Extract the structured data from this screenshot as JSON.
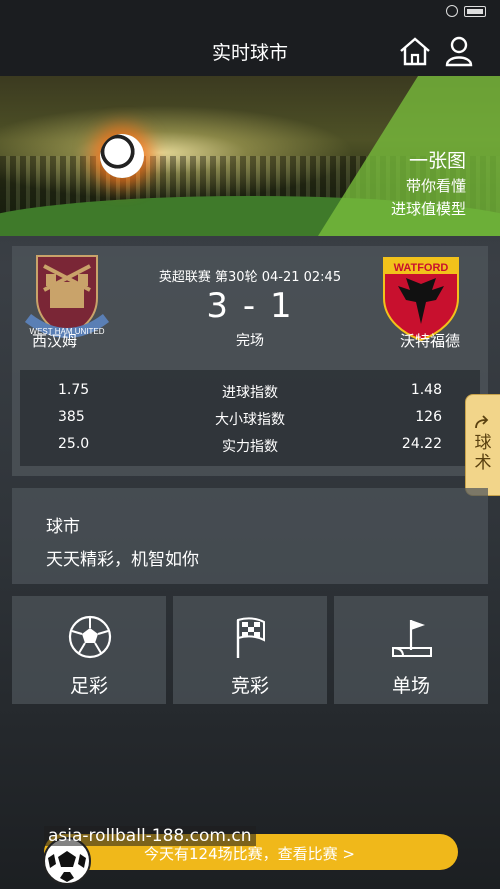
{
  "nav": {
    "title": "实时球市"
  },
  "banner": {
    "line1": "一张图",
    "line2": "带你看懂",
    "line3": "进球值模型"
  },
  "match": {
    "league_round_time": "英超联赛 第30轮 04-21 02:45",
    "score": "3 - 1",
    "status": "完场",
    "home": {
      "name": "西汉姆",
      "logo_text": "WEST HAM UNITED"
    },
    "away": {
      "name": "沃特福德",
      "logo_text": "WATFORD"
    },
    "indices": [
      {
        "label": "进球指数",
        "home": "1.75",
        "away": "1.48"
      },
      {
        "label": "大小球指数",
        "home": "385",
        "away": "126"
      },
      {
        "label": "实力指数",
        "home": "25.0",
        "away": "24.22"
      }
    ]
  },
  "side_tab": {
    "label": "球术"
  },
  "market": {
    "title": "球市",
    "subtitle": "天天精彩，机智如你"
  },
  "tiles": [
    {
      "label": "足彩",
      "icon": "soccer-ball-icon"
    },
    {
      "label": "竞彩",
      "icon": "checkered-flag-icon"
    },
    {
      "label": "单场",
      "icon": "corner-flag-icon"
    }
  ],
  "bottom": {
    "text": "今天有124场比赛，查看比赛 >",
    "watermark": "asia-rollball-188.com.cn"
  },
  "colors": {
    "accent": "#f0b81a",
    "side_tab": "#f2d58a",
    "navbar": "#1b1d20"
  }
}
